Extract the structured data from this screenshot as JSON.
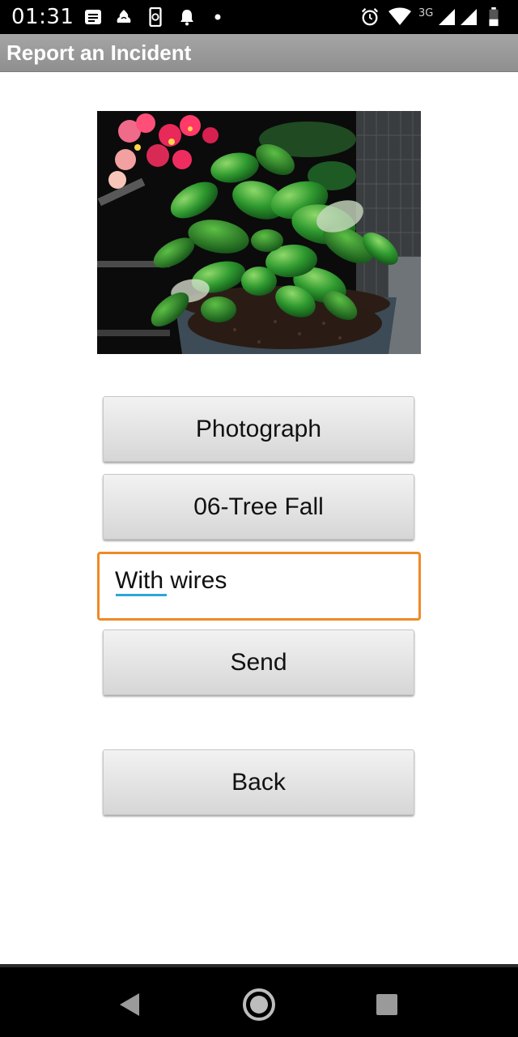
{
  "status_bar": {
    "time": "01:31",
    "network_label": "3G",
    "icons": [
      "notes-icon",
      "bank-icon",
      "phone-sync-icon",
      "bell-icon",
      "dot-icon",
      "alarm-icon",
      "wifi-icon",
      "signal-icon",
      "signal-icon",
      "battery-icon"
    ]
  },
  "app": {
    "title": "Report an Incident"
  },
  "photo": {
    "description_icon": "plant-photo"
  },
  "buttons": {
    "photograph": "Photograph",
    "category": "06-Tree Fall",
    "send": "Send",
    "back": "Back"
  },
  "note_field": {
    "value": "With wires",
    "focus_color": "#ee8a25"
  },
  "nav_bar": {
    "icons": [
      "back-triangle-icon",
      "home-circle-icon",
      "recents-square-icon"
    ]
  }
}
